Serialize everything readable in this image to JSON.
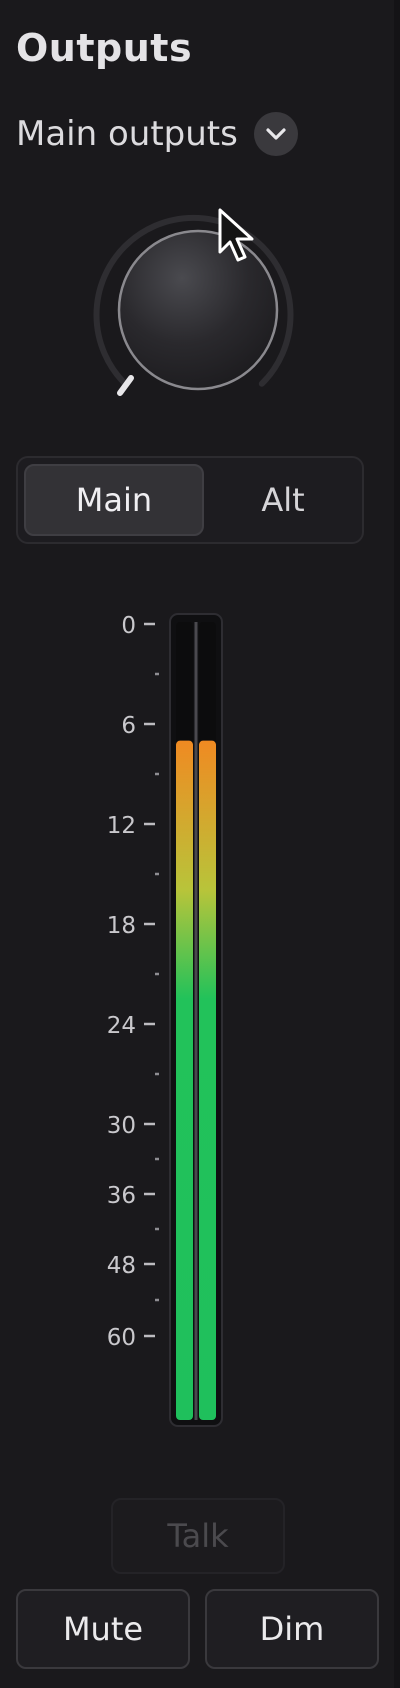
{
  "panel": {
    "title": "Outputs",
    "output_select": {
      "label": "Main outputs",
      "icon": "chevron-down-icon"
    }
  },
  "volume_knob": {
    "icon": "rotary-knob"
  },
  "monitor_switch": {
    "options": [
      "Main",
      "Alt"
    ],
    "selected": "Main"
  },
  "level_meter": {
    "unit": "dB",
    "scale_labels": [
      "0",
      "6",
      "12",
      "18",
      "24",
      "30",
      "36",
      "48",
      "60"
    ],
    "minor_ticks": [
      3,
      9,
      15,
      21,
      27,
      33,
      42,
      54
    ],
    "channels": [
      {
        "level_db": 7
      },
      {
        "level_db": 7
      }
    ],
    "colors": {
      "low": "#1fc05c",
      "mid": "#b8c43a",
      "high": "#f08a22",
      "track": "#0c0c0d"
    }
  },
  "buttons": {
    "talk": "Talk",
    "mute": "Mute",
    "dim": "Dim"
  }
}
